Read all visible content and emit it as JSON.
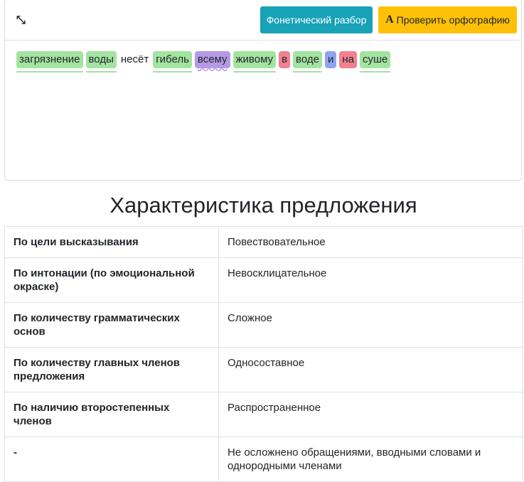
{
  "toolbar": {
    "phonetic_label": "Фонетический разбор",
    "spell_icon": "A",
    "spell_label": "Проверить орфографию"
  },
  "words": [
    "загрязнение",
    "воды",
    "несёт",
    "гибель",
    "всему",
    "живому",
    "в",
    "воде",
    "и",
    "на",
    "суше"
  ],
  "heading": "Характеристика предложения",
  "table": [
    [
      "По цели высказывания",
      "Повествовательное"
    ],
    [
      "По интонации (по эмоциональной окраске)",
      "Невосклицательное"
    ],
    [
      "По количеству грамматических основ",
      "Сложное"
    ],
    [
      "По количеству главных членов предложения",
      "Односоставное"
    ],
    [
      "По наличию второстепенных членов",
      "Распространенное"
    ],
    [
      "-",
      "Не осложнено обращениями, вводными словами и однородными членами"
    ]
  ]
}
